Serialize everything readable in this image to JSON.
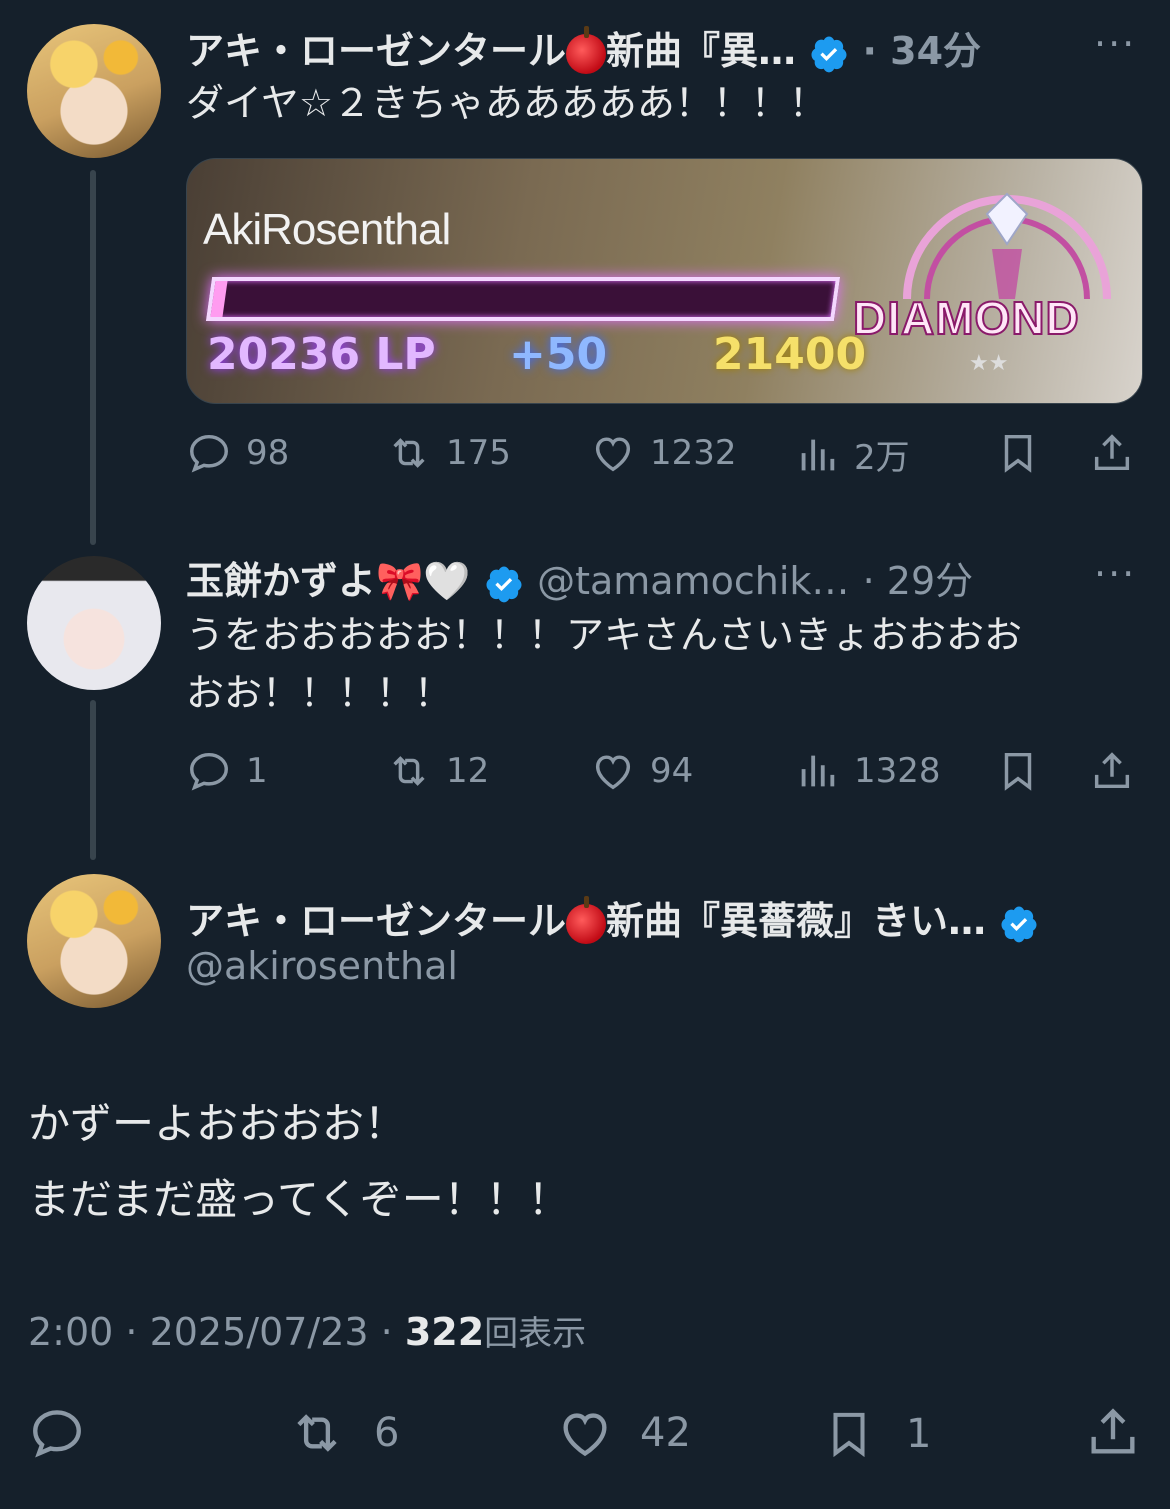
{
  "tweets": [
    {
      "author": "アキ・ローゼンタール",
      "author_suffix": "新曲『異…",
      "time": "· 34分",
      "text": "ダイヤ☆２きちゃあああああ！！！！",
      "media": {
        "player": "AkiRosenthal",
        "lp": "20236 LP",
        "gain": "+50",
        "target": "21400",
        "rank": "DIAMOND",
        "stars": "★★",
        "progress_fraction": 0.02
      },
      "stats": {
        "replies": "98",
        "retweets": "175",
        "likes": "1232",
        "views": "2万"
      }
    },
    {
      "author": "玉餅かずよ🎀🤍",
      "handle": "@tamamochik…",
      "time": "· 29分",
      "text_line1": "うをおおおおお！！！アキさんさいきょおおおお",
      "text_line2": "おお！！！！！",
      "stats": {
        "replies": "1",
        "retweets": "12",
        "likes": "94",
        "views": "1328"
      }
    }
  ],
  "main": {
    "author": "アキ・ローゼンタール",
    "author_suffix": "新曲『異薔薇』きい…",
    "handle": "@akirosenthal",
    "line1": "かずーよおおおお！",
    "line2": "まだまだ盛ってくぞー！！！",
    "time": "2:00 · 2025/07/23 · ",
    "view_count": "322",
    "view_label": "回表示",
    "stats": {
      "retweets": "6",
      "likes": "42",
      "bookmarks": "1"
    }
  },
  "more_label": "···",
  "colors": {
    "background": "#15202b",
    "verified": "#1d9bf0",
    "muted": "#8b98a5"
  }
}
